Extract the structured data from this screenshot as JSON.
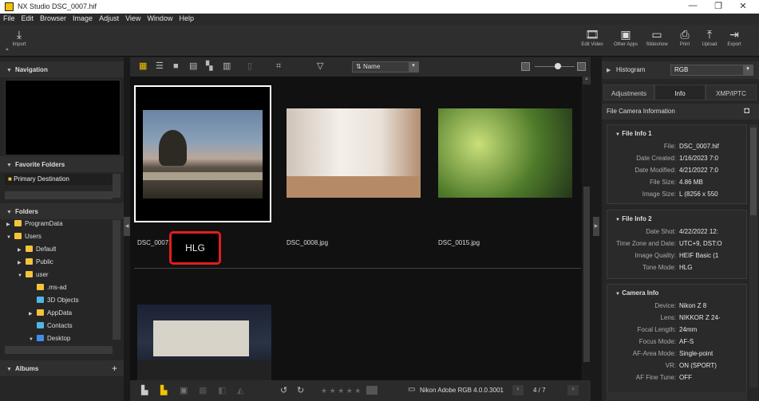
{
  "window": {
    "title": "NX Studio   DSC_0007.hif",
    "min": "—",
    "max": "❐",
    "close": "✕"
  },
  "menu": [
    "File",
    "Edit",
    "Browser",
    "Image",
    "Adjust",
    "View",
    "Window",
    "Help"
  ],
  "toolbar": {
    "import_label": "Import",
    "right_buttons": [
      {
        "label": "Edit Video",
        "icon": "edit-video-icon"
      },
      {
        "label": "Other Apps",
        "icon": "other-apps-icon"
      },
      {
        "label": "Slideshow",
        "icon": "slideshow-icon"
      },
      {
        "label": "Print",
        "icon": "print-icon"
      },
      {
        "label": "Upload",
        "icon": "upload-icon"
      },
      {
        "label": "Export",
        "icon": "export-icon"
      }
    ]
  },
  "left": {
    "navigation": "Navigation",
    "favorite_folders": "Favorite Folders",
    "primary_destination": "Primary Destination",
    "folders": "Folders",
    "tree": [
      {
        "label": "ProgramData",
        "level": 1,
        "tri": "▶",
        "color": "yellow"
      },
      {
        "label": "Users",
        "level": 1,
        "tri": "▼",
        "color": "yellow"
      },
      {
        "label": "Default",
        "level": 2,
        "tri": "▶",
        "color": "yellow"
      },
      {
        "label": "Public",
        "level": 2,
        "tri": "▶",
        "color": "yellow"
      },
      {
        "label": "user",
        "level": 2,
        "tri": "▼",
        "color": "yellow"
      },
      {
        "label": ".ms-ad",
        "level": 3,
        "tri": "",
        "color": "yellow"
      },
      {
        "label": "3D Objects",
        "level": 3,
        "tri": "",
        "color": "cyan"
      },
      {
        "label": "AppData",
        "level": 3,
        "tri": "▶",
        "color": "yellow"
      },
      {
        "label": "Contacts",
        "level": 3,
        "tri": "",
        "color": "cyan"
      },
      {
        "label": "Desktop",
        "level": 3,
        "tri": "▼",
        "color": "blue"
      }
    ],
    "albums": "Albums",
    "albums_add": "+"
  },
  "main": {
    "sort_label": "Name",
    "thumbnails": [
      {
        "name": "DSC_0007.hif",
        "badge": "HLG"
      },
      {
        "name": "DSC_0008.jpg"
      },
      {
        "name": "DSC_0015.jpg"
      },
      {
        "name": ""
      }
    ],
    "bottom": {
      "stars": "★ ★ ★ ★ ★",
      "color_profile": "Nikon Adobe RGB 4.0.0.3001",
      "page": "4 / 7"
    }
  },
  "right": {
    "histogram": "Histogram",
    "histogram_mode": "RGB",
    "tabs": [
      "Adjustments",
      "Info",
      "XMP/IPTC"
    ],
    "info_header": "File  Camera Information",
    "sections": [
      {
        "title": "File Info 1",
        "rows": [
          {
            "k": "File:",
            "v": "DSC_0007.hif"
          },
          {
            "k": "Date Created:",
            "v": "1/16/2023 7:0"
          },
          {
            "k": "Date Modified:",
            "v": "4/21/2022 7:0"
          },
          {
            "k": "File Size:",
            "v": "4.86 MB"
          },
          {
            "k": "Image Size:",
            "v": "L (8256 x 550"
          }
        ]
      },
      {
        "title": "File Info 2",
        "rows": [
          {
            "k": "Date Shot:",
            "v": "4/22/2022 12:"
          },
          {
            "k": "Time Zone and Date:",
            "v": "UTC+9, DST:O"
          },
          {
            "k": "Image Quality:",
            "v": "HEIF Basic (1"
          },
          {
            "k": "Tone Mode:",
            "v": "HLG"
          }
        ]
      },
      {
        "title": "Camera Info",
        "rows": [
          {
            "k": "Device:",
            "v": "Nikon Z 8"
          },
          {
            "k": "Lens:",
            "v": "NIKKOR Z 24-"
          },
          {
            "k": "Focal Length:",
            "v": "24mm"
          },
          {
            "k": "Focus Mode:",
            "v": "AF-S"
          },
          {
            "k": "AF-Area Mode:",
            "v": "Single-point"
          },
          {
            "k": "VR:",
            "v": "ON (SPORT)"
          },
          {
            "k": "AF Fine Tune:",
            "v": "OFF"
          }
        ]
      }
    ]
  },
  "colors": {
    "accent": "#f2c200",
    "highlight_box": "#e11d1d",
    "selection": "#ffffff"
  }
}
